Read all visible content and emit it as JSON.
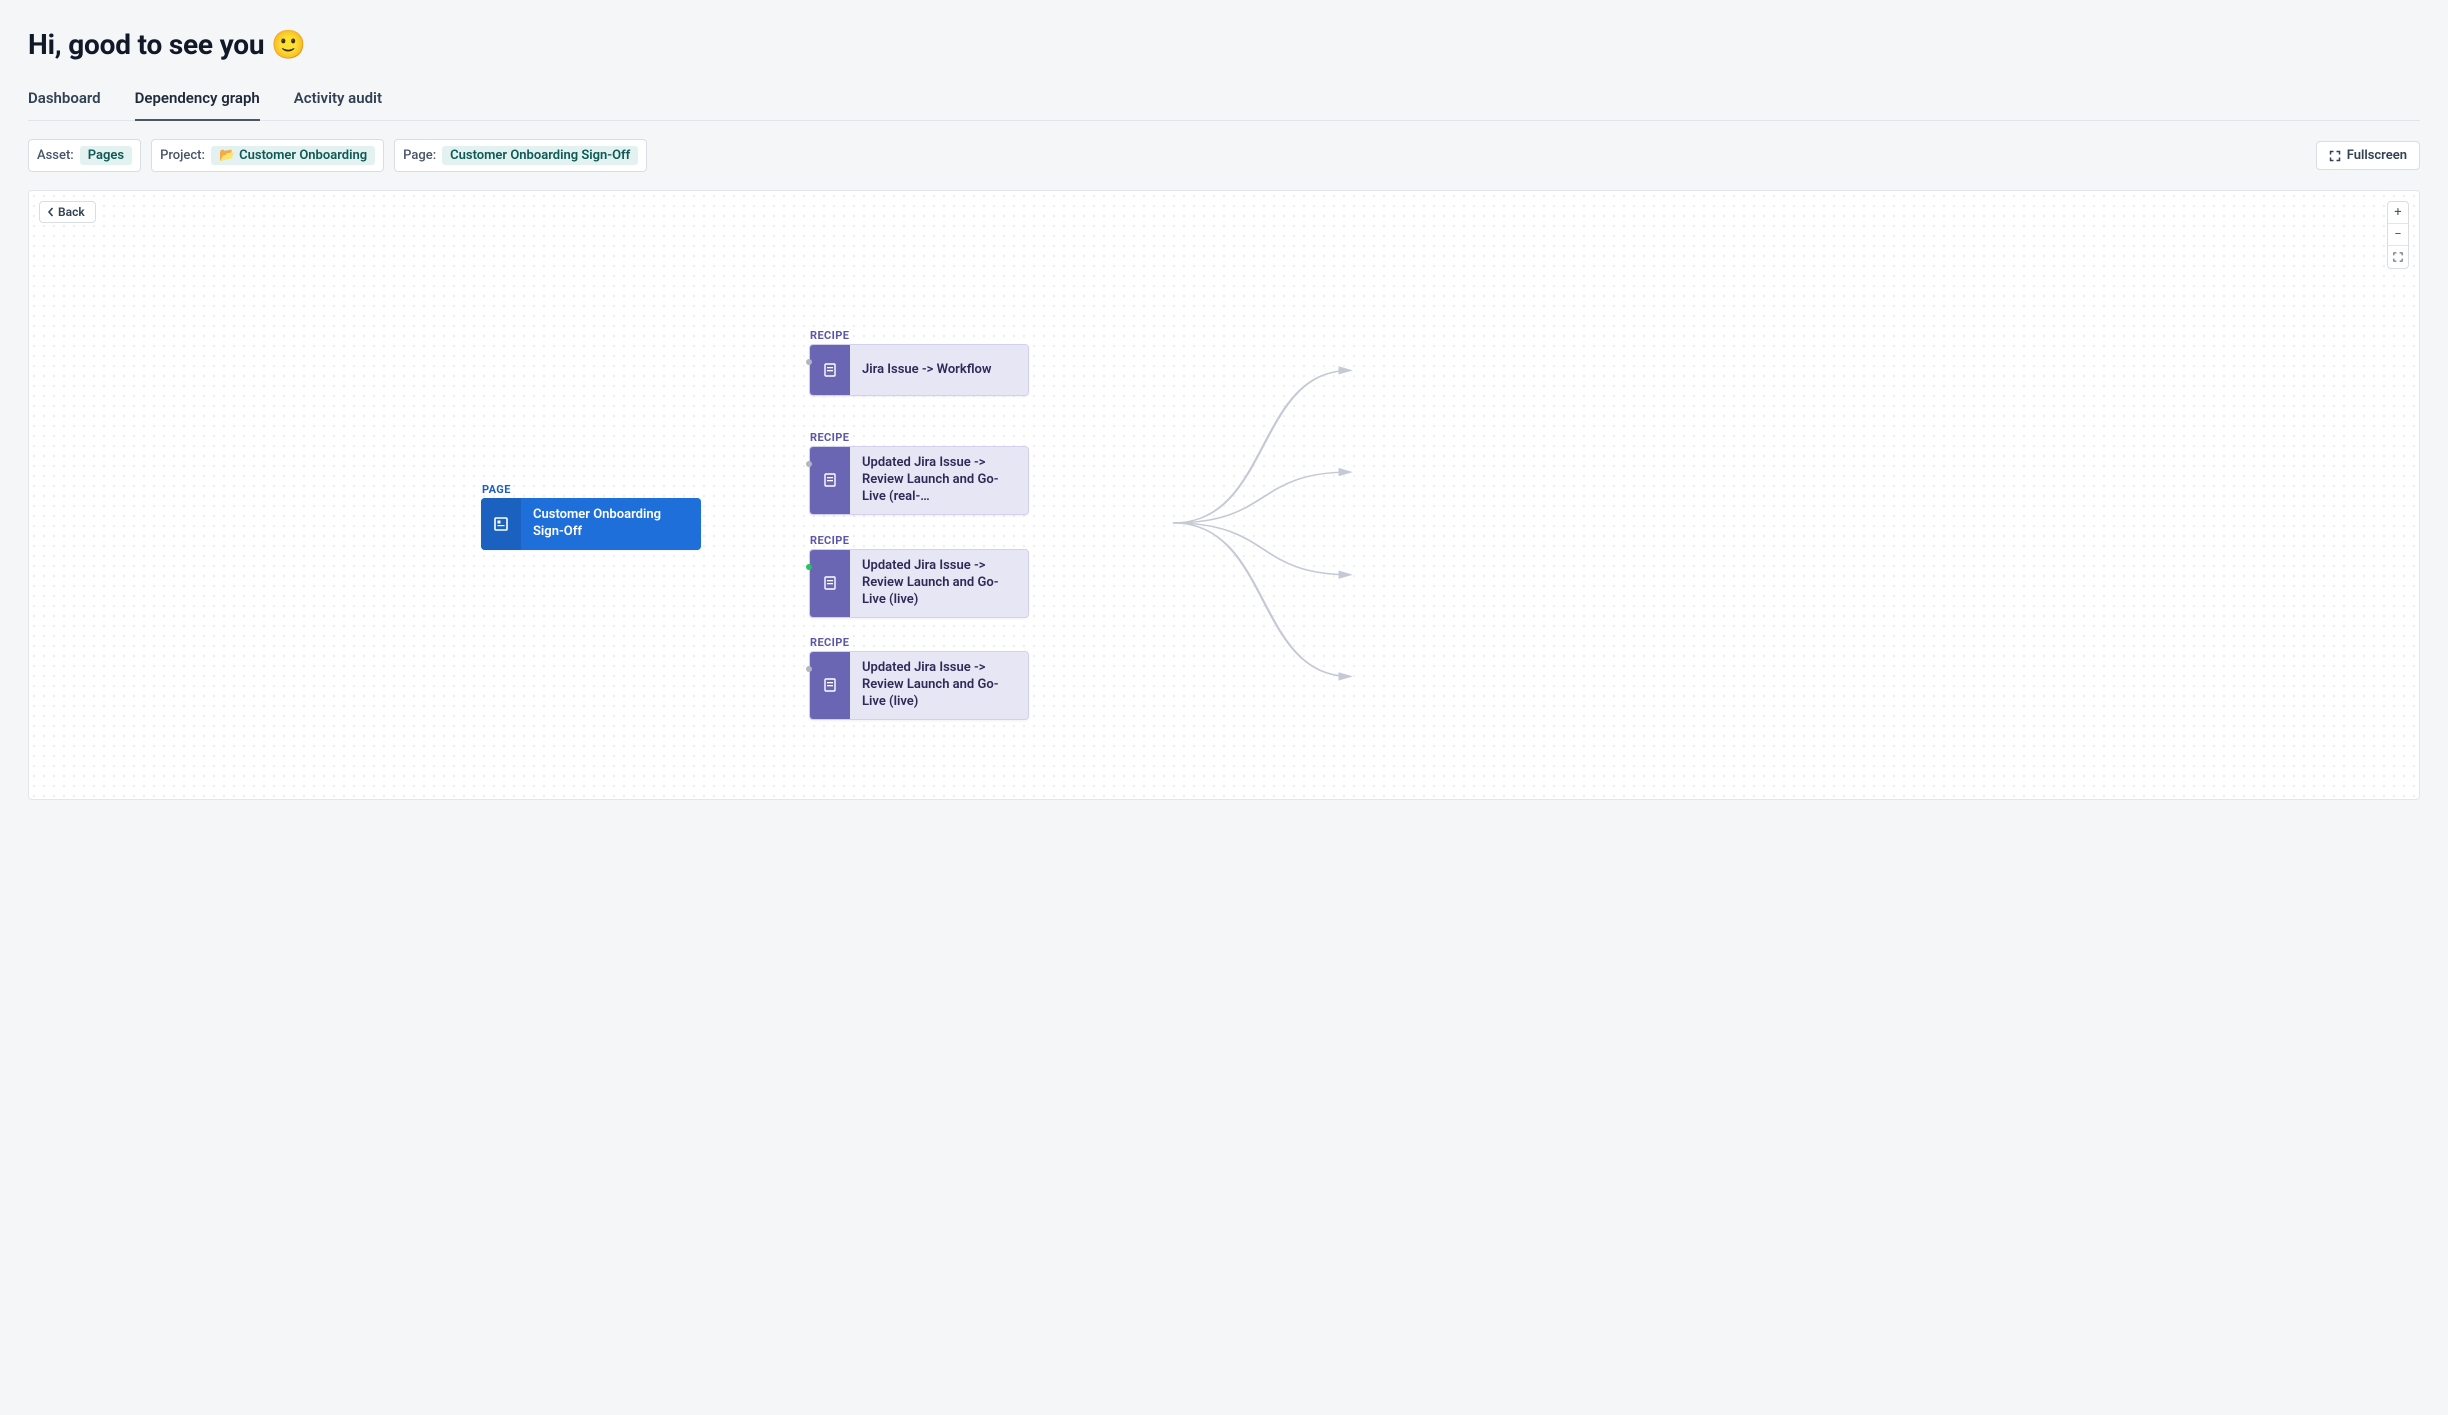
{
  "header": {
    "title": "Hi, good to see you 🙂"
  },
  "tabs": [
    {
      "label": "Dashboard",
      "active": false
    },
    {
      "label": "Dependency graph",
      "active": true
    },
    {
      "label": "Activity audit",
      "active": false
    }
  ],
  "filters": {
    "asset": {
      "label": "Asset:",
      "value": "Pages"
    },
    "project": {
      "label": "Project:",
      "emoji": "📂",
      "value": "Customer Onboarding"
    },
    "page": {
      "label": "Page:",
      "value": "Customer Onboarding Sign-Off"
    }
  },
  "buttons": {
    "fullscreen": "Fullscreen",
    "back": "Back"
  },
  "graph": {
    "root": {
      "caption": "PAGE",
      "label": "Customer Onboarding Sign-Off"
    },
    "recipes": [
      {
        "caption": "RECIPE",
        "label": "Jira Issue -> Workflow",
        "status": "grey"
      },
      {
        "caption": "RECIPE",
        "label": "Updated Jira Issue -> Review Launch and Go-Live (real-…",
        "status": "grey"
      },
      {
        "caption": "RECIPE",
        "label": "Updated Jira Issue -> Review Launch and Go-Live (live)",
        "status": "green"
      },
      {
        "caption": "RECIPE",
        "label": "Updated Jira Issue -> Review Launch and Go-Live (live)",
        "status": "grey"
      }
    ]
  }
}
